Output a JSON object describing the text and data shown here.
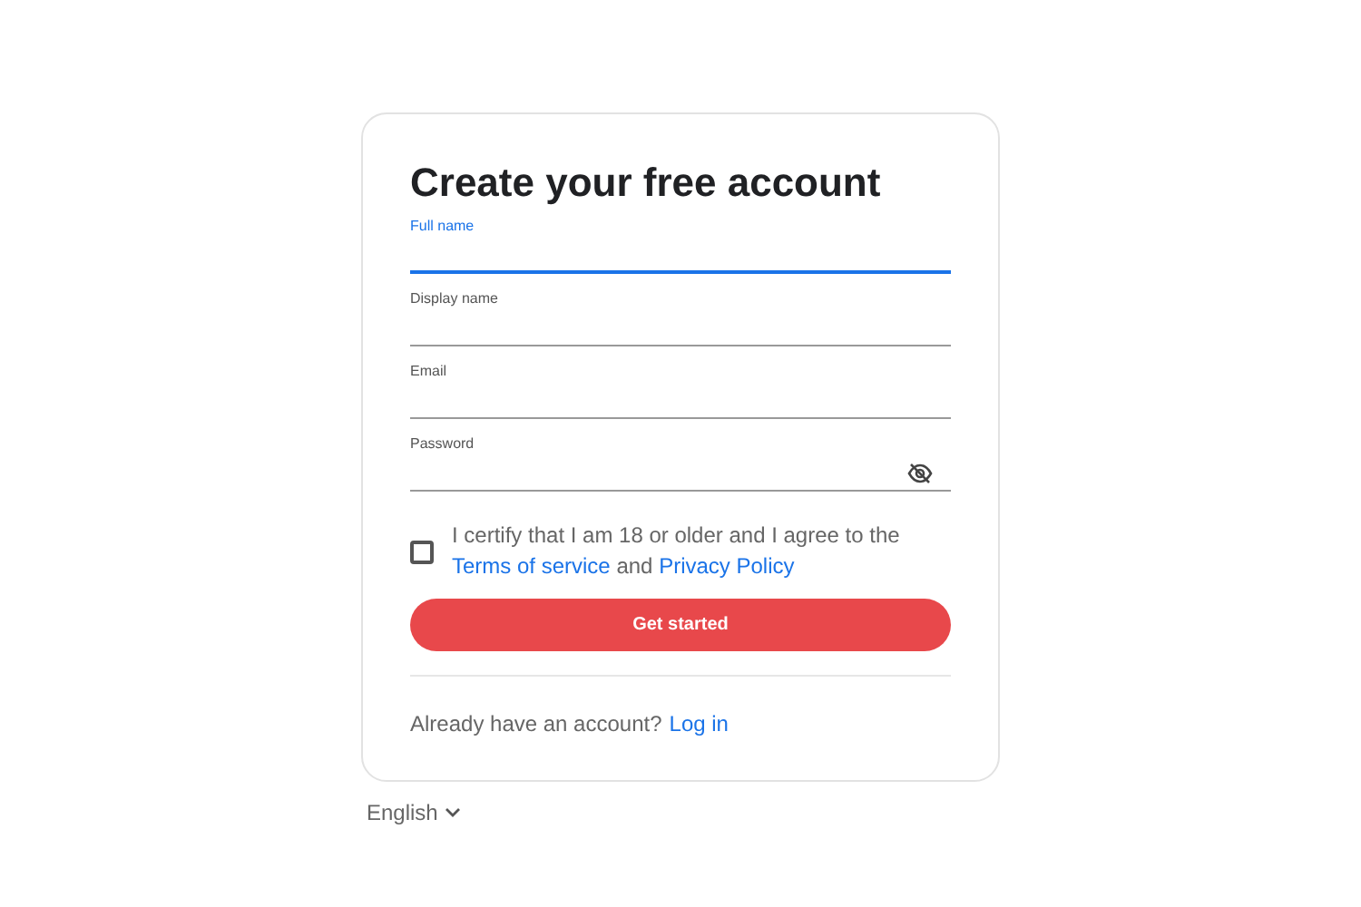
{
  "title": "Create your free account",
  "fields": [
    {
      "label": "Full name",
      "kind": "text",
      "focused": true
    },
    {
      "label": "Display name",
      "kind": "text",
      "focused": false
    },
    {
      "label": "Email",
      "kind": "text",
      "focused": false
    },
    {
      "label": "Password",
      "kind": "password",
      "focused": false
    }
  ],
  "agreement": {
    "checked": false,
    "parts": [
      {
        "kind": "text",
        "text": "I certify that I am 18 or older and I agree to the "
      },
      {
        "kind": "link",
        "text": "Terms of service"
      },
      {
        "kind": "text",
        "text": " and "
      },
      {
        "kind": "link",
        "text": "Privacy Policy"
      }
    ]
  },
  "submit_button": "Get started",
  "login_prompt": {
    "text": "Already have an account?",
    "link": "Log in"
  },
  "language": "English"
}
